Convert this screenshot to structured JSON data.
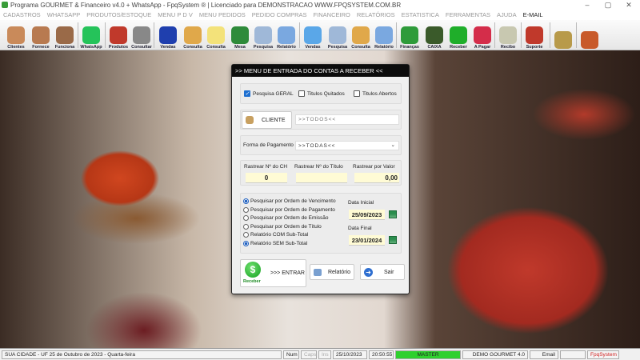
{
  "window": {
    "title": "Programa GOURMET & Financeiro v4.0 + WhatsApp - FpqSystem ® | Licenciado para  DEMONSTRACAO WWW.FPQSYSTEM.COM.BR",
    "minimize": "–",
    "maximize": "▢",
    "close": "✕"
  },
  "menu": [
    "CADASTROS",
    "WHATSAPP",
    "PRODUTOS/ESTOQUE",
    "MENU P D V",
    "MENU PEDIDOS",
    "PEDIDO COMPRAS",
    "FINANCEIRO",
    "RELATÓRIOS",
    "ESTATISTICA",
    "FERRAMENTAS",
    "AJUDA",
    "E-MAIL"
  ],
  "toolbar": [
    {
      "label": "Clientes",
      "color": "#c98a5a"
    },
    {
      "label": "Fornece",
      "color": "#b87a50"
    },
    {
      "label": "Funciona",
      "color": "#9a6a48"
    },
    {
      "label": "WhatsApp",
      "color": "#25c35a"
    },
    {
      "label": "Produtos",
      "color": "#c0392b"
    },
    {
      "label": "Consultar",
      "color": "#888888"
    },
    {
      "label": "Vendas",
      "color": "#1f3fae"
    },
    {
      "label": "Consulta",
      "color": "#e0a84a"
    },
    {
      "label": "Consulta",
      "color": "#f3e27a"
    },
    {
      "label": "Mesa",
      "color": "#2e8b3a"
    },
    {
      "label": "Pesquisa",
      "color": "#9fb8d8"
    },
    {
      "label": "Relatório",
      "color": "#7aa8e0"
    },
    {
      "label": "Vendas",
      "color": "#5aa7e8"
    },
    {
      "label": "Pesquisa",
      "color": "#9fb8d8"
    },
    {
      "label": "Consulta",
      "color": "#e0a84a"
    },
    {
      "label": "Relatório",
      "color": "#7aa8e0"
    },
    {
      "label": "Finanças",
      "color": "#2e9b3a"
    },
    {
      "label": "CAIXA",
      "color": "#3a5a2a"
    },
    {
      "label": "Receber",
      "color": "#1fae2a"
    },
    {
      "label": "A Pagar",
      "color": "#d42d4a"
    },
    {
      "label": "Recibo",
      "color": "#c8c8b0"
    },
    {
      "label": "Suporte",
      "color": "#c0392b"
    },
    {
      "label": "",
      "color": "#b89a4a"
    },
    {
      "label": "",
      "color": "#c85a2a"
    }
  ],
  "dialog": {
    "title": ">>  MENU DE ENTRADA DO CONTAS A RECEBER  <<",
    "checks": [
      {
        "label": "Pesquisa GERAL",
        "checked": true
      },
      {
        "label": "Titulos Quitados",
        "checked": false
      },
      {
        "label": "Titulos Abertos",
        "checked": false
      }
    ],
    "cliente_button": "CLIENTE",
    "cliente_value": ">>TODOS<<",
    "forma_label": "Forma de Pagamento",
    "forma_value": ">>TODAS<<",
    "rastrear": [
      {
        "label": "Rastrear Nº do CH",
        "value": "0"
      },
      {
        "label": "Rastrear Nº do Título",
        "value": ""
      },
      {
        "label": "Rastrear por Valor",
        "value": "0,00"
      }
    ],
    "radios": [
      {
        "label": "Pesquisar por Ordem de Vencimento",
        "selected": true
      },
      {
        "label": "Pesquisar por Ordem de Pagamento",
        "selected": false
      },
      {
        "label": "Pesquisar por Ordem de Emissão",
        "selected": false
      },
      {
        "label": "Pesquisar por Ordem de Título",
        "selected": false
      },
      {
        "label": "Relatório COM Sub-Total",
        "selected": false
      },
      {
        "label": "Relatório SEM Sub-Total",
        "selected": true
      }
    ],
    "data_inicial_label": "Data Inicial",
    "data_inicial": "25/09/2023",
    "data_final_label": "Data Final",
    "data_final": "23/01/2024",
    "entrar_icon_label": "Receber",
    "entrar": ">>> ENTRAR",
    "relatorio": "Relatório",
    "sair": "Sair"
  },
  "status": {
    "city": "SUA CIDADE - UF 25 de Outubro de 2023 - Quarta-feira",
    "num": "Num",
    "caps": "Caps",
    "ins": "Ins",
    "date": "25/10/2023",
    "time": "20:50:55",
    "user": "MASTER",
    "company": "DEMO GOURMET 4.0",
    "email": "Email",
    "brand": "FpqSystem"
  }
}
